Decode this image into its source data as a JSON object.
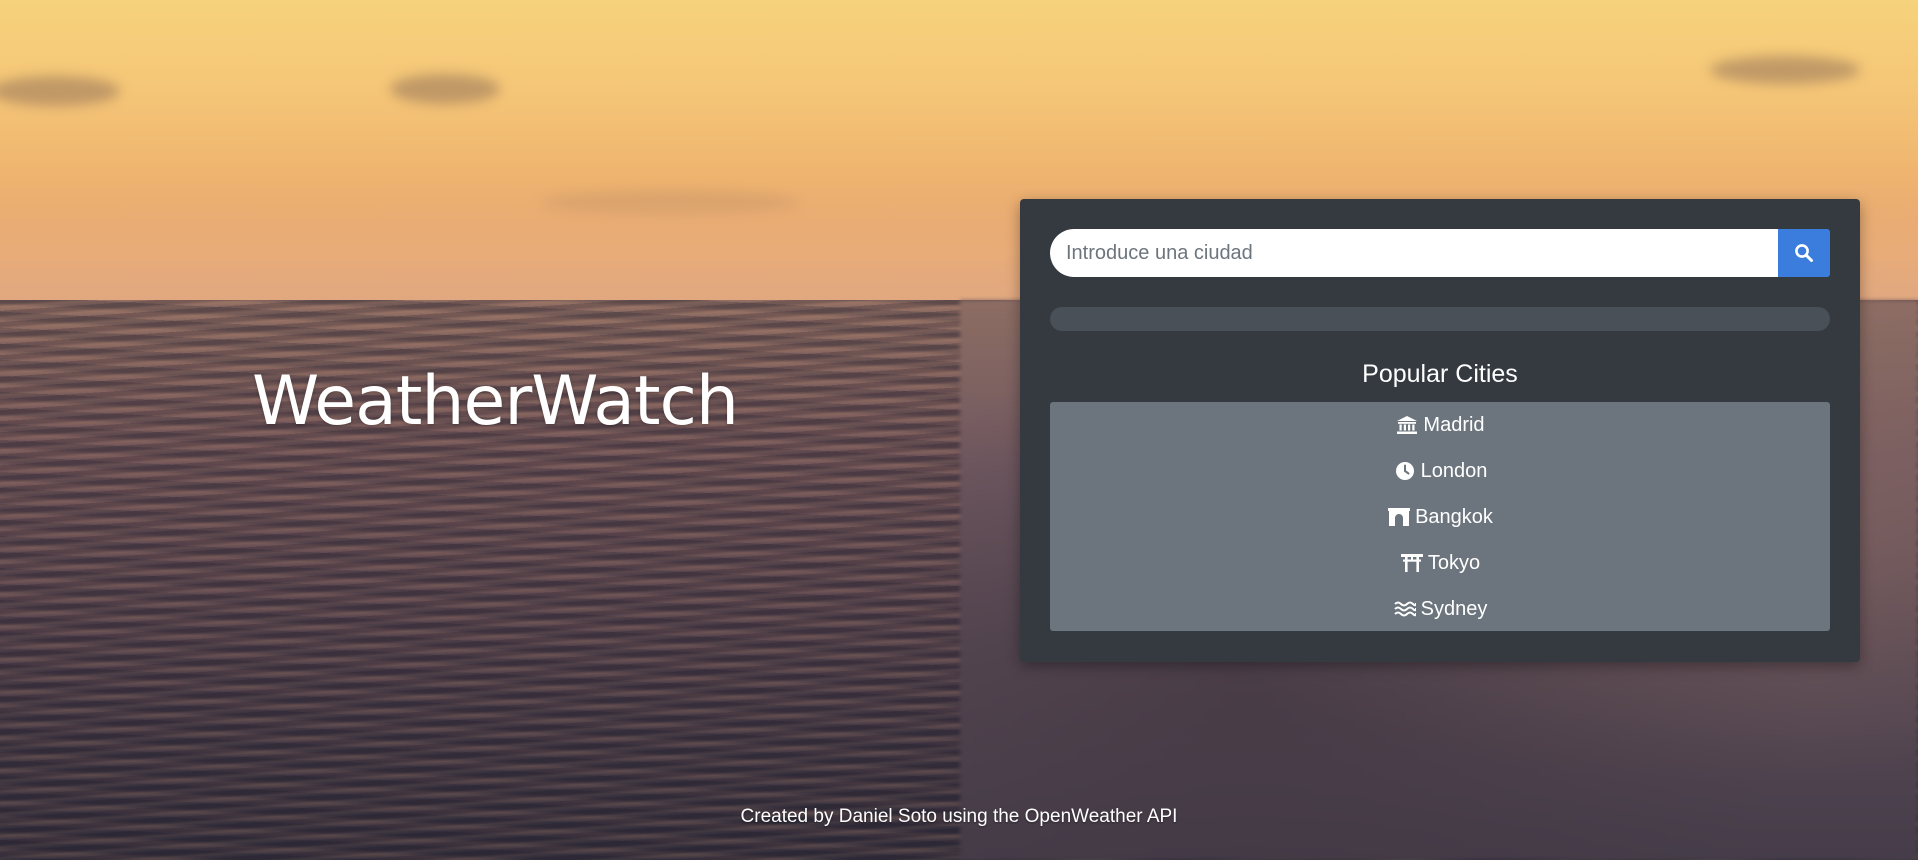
{
  "app": {
    "title": "WeatherWatch"
  },
  "search": {
    "placeholder": "Introduce una ciudad",
    "value": "",
    "button_icon": "search-icon"
  },
  "progress": {
    "value": 0
  },
  "popular": {
    "title": "Popular Cities",
    "cities": [
      {
        "label": "Madrid",
        "icon": "landmark-icon"
      },
      {
        "label": "London",
        "icon": "clock-icon"
      },
      {
        "label": "Bangkok",
        "icon": "archway-icon"
      },
      {
        "label": "Tokyo",
        "icon": "torii-gate-icon"
      },
      {
        "label": "Sydney",
        "icon": "water-icon"
      }
    ]
  },
  "footer": {
    "text": "Created by Daniel Soto using the OpenWeather API"
  },
  "colors": {
    "panel": "#343a40",
    "list": "#6c757d",
    "accent": "#3b7ddd",
    "progress_track": "#495057"
  }
}
